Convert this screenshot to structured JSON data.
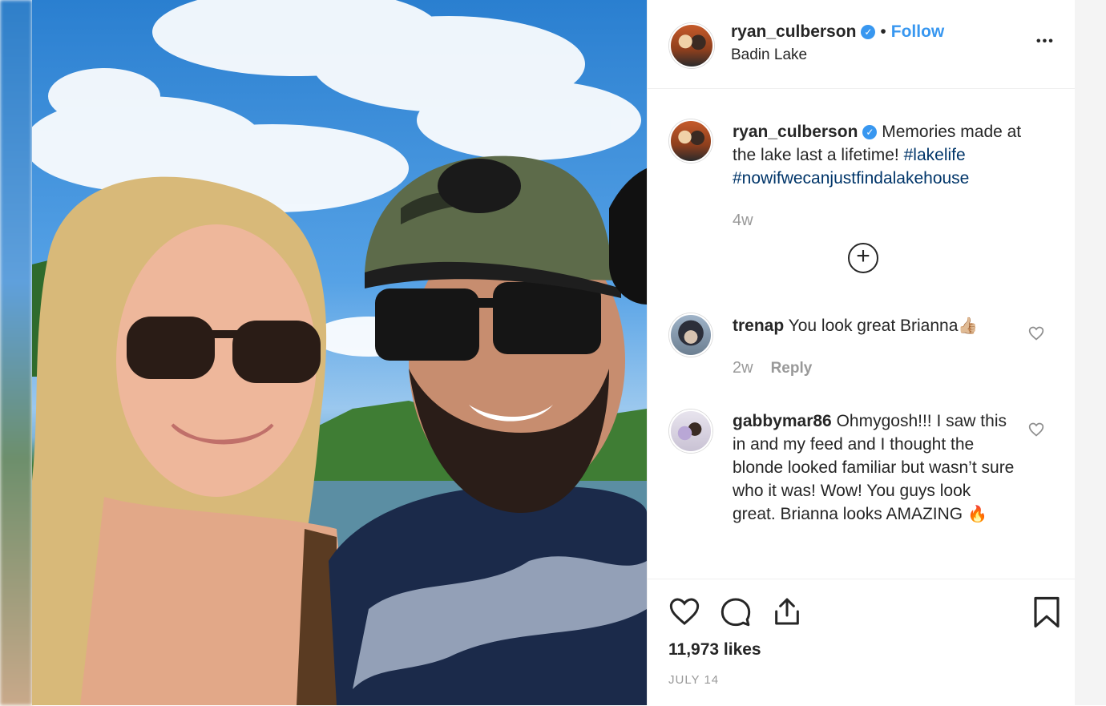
{
  "post": {
    "username": "ryan_culberson",
    "verified_glyph": "✓",
    "separator": "•",
    "follow_label": "Follow",
    "location": "Badin Lake",
    "more_label": "•••"
  },
  "caption": {
    "username": "ryan_culberson",
    "text": "Memories made at the lake last a lifetime!",
    "hashtag1": "#lakelife",
    "hashtag2": "#nowifwecanjustfindalakehouse",
    "age": "4w",
    "load_more_label": "+"
  },
  "comments": [
    {
      "username": "trenap",
      "text": "You look great Brianna",
      "emoji": "👍🏼",
      "age": "2w",
      "reply_label": "Reply"
    },
    {
      "username": "gabbymar86",
      "text": "Ohmygosh!!! I saw this in and my feed and I thought the blonde looked familiar but wasn’t sure who it was! Wow! You guys look great. Brianna looks AMAZING",
      "emoji": "🔥"
    }
  ],
  "footer": {
    "likes": "11,973 likes",
    "date": "JULY 14"
  },
  "icons": {
    "like": "heart-icon",
    "comment": "comment-icon",
    "share": "share-icon",
    "save": "bookmark-icon"
  },
  "colors": {
    "link_blue": "#3897f0",
    "hashtag": "#003569",
    "muted": "#999999",
    "text": "#262626"
  }
}
